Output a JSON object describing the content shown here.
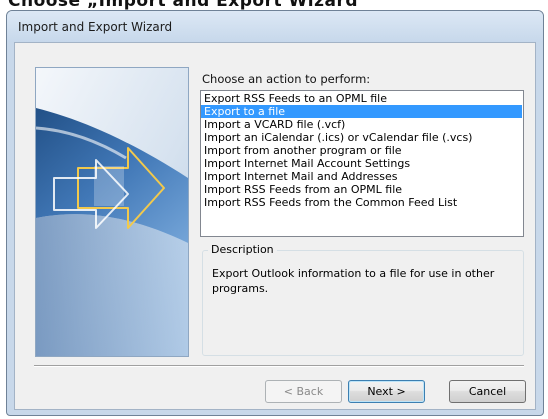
{
  "header_fragment": "Choose „Import and Export Wizard\"",
  "window": {
    "title": "Import and Export Wizard"
  },
  "wizard": {
    "prompt": "Choose an action to perform:",
    "actions": [
      "Export RSS Feeds to an OPML file",
      "Export to a file",
      "Import a VCARD file (.vcf)",
      "Import an iCalendar (.ics) or vCalendar file (.vcs)",
      "Import from another program or file",
      "Import Internet Mail Account Settings",
      "Import Internet Mail and Addresses",
      "Import RSS Feeds from an OPML file",
      "Import RSS Feeds from the Common Feed List"
    ],
    "selected_action": "Export to a file",
    "description_label": "Description",
    "description_text": "Export Outlook information to a file for use in other programs."
  },
  "buttons": {
    "back": "< Back",
    "next": "Next >",
    "cancel": "Cancel"
  },
  "colors": {
    "selection": "#3399ff",
    "window_frame": "#c8d8ea"
  }
}
